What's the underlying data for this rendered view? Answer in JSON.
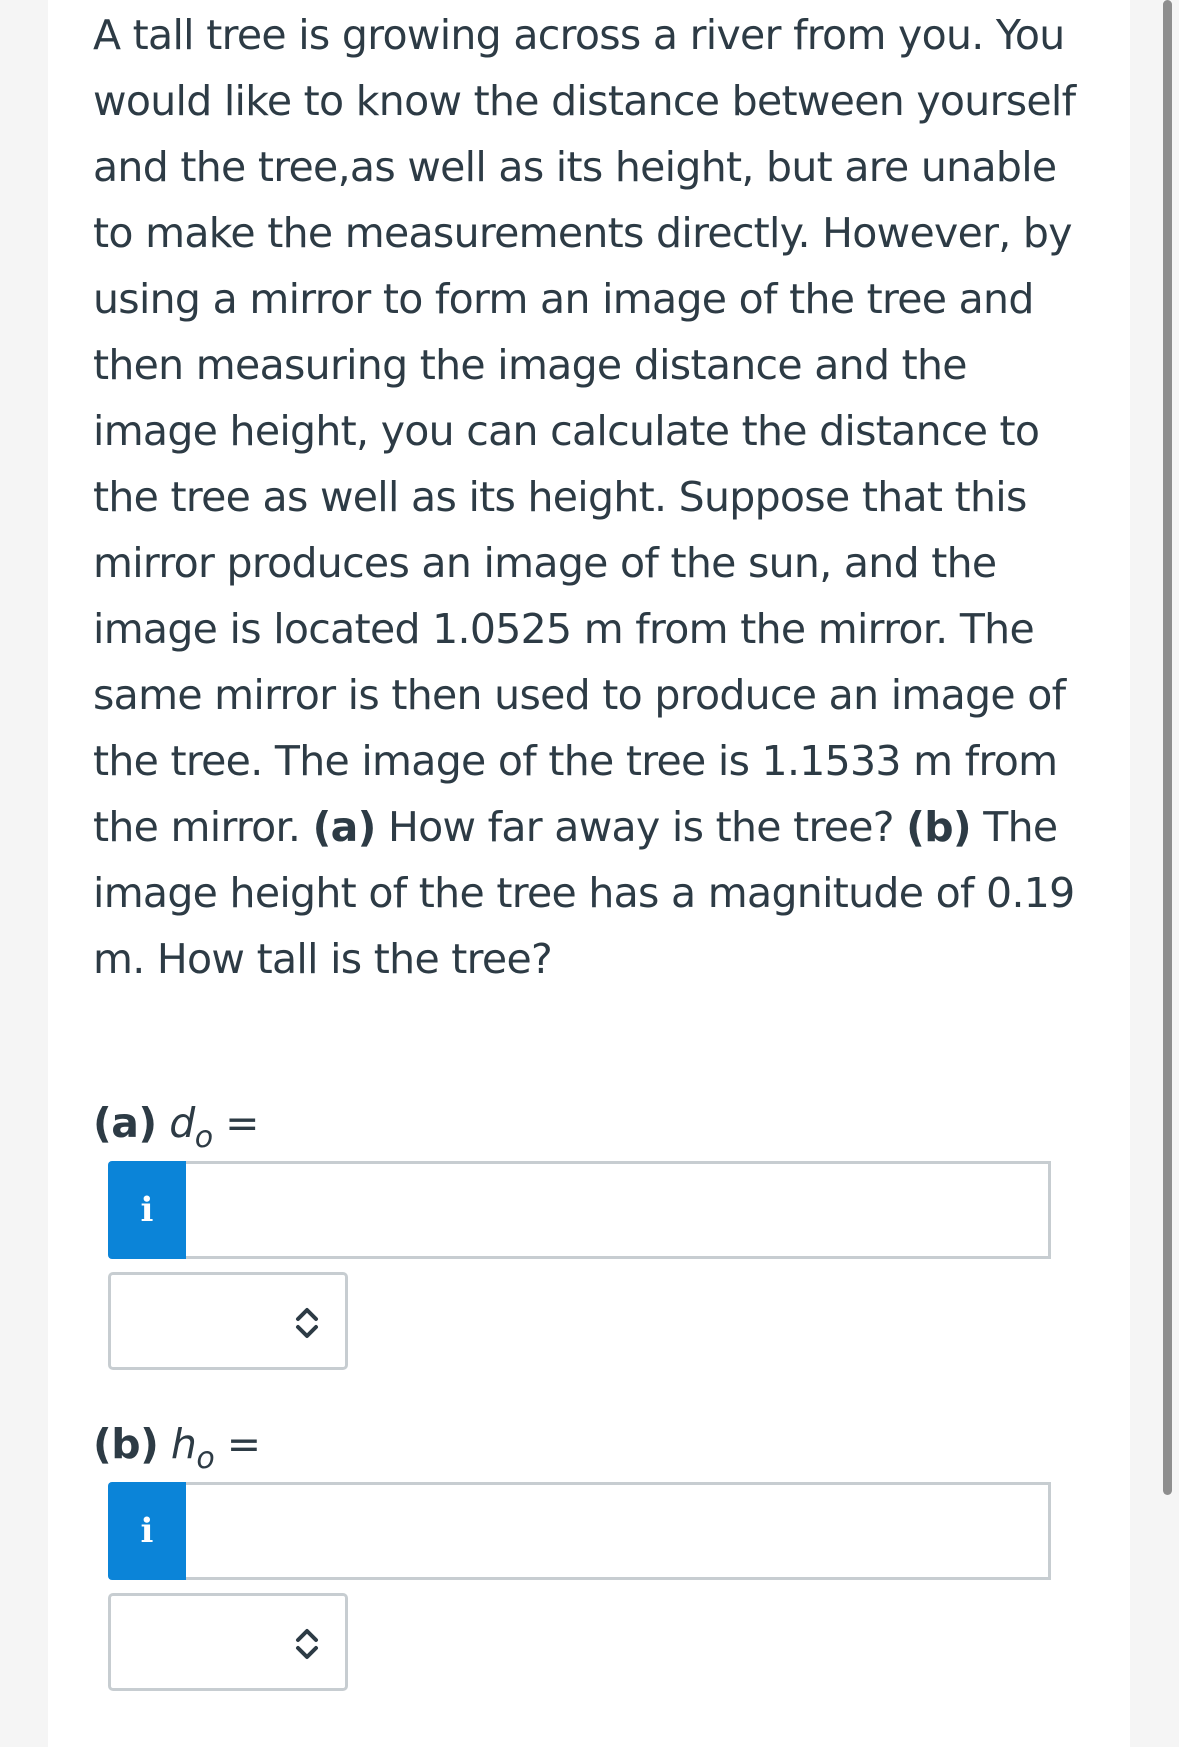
{
  "question": {
    "text_1": "A tall tree is growing across a river from you. You would like to know the distance between yourself and the tree,as well as its height, but are unable to make the measurements directly. However, by using a mirror to form an image of the tree and then measuring the image distance and the image height, you can calculate the distance to the tree as well as its height. Suppose that this mirror produces an image of the sun, and the image is located 1.0525 m from the mirror. The same mirror is then used to produce an image of the tree. The image of the tree is 1.1533 m from the mirror. ",
    "part_a_marker": "(a)",
    "text_2": " How far away is the tree? ",
    "part_b_marker": "(b)",
    "text_3": " The image height of the tree has a magnitude of 0.19 m. How tall is the tree?"
  },
  "part_a": {
    "marker": "(a)",
    "variable": "d",
    "subscript": "o",
    "equals": "=",
    "info_label": "i",
    "value": "",
    "unit_value": ""
  },
  "part_b": {
    "marker": "(b)",
    "variable": "h",
    "subscript": "o",
    "equals": "=",
    "info_label": "i",
    "value": "",
    "unit_value": ""
  },
  "icons": {
    "info": "info-icon",
    "select": "chevron-up-down-icon"
  },
  "colors": {
    "info_button": "#0b84d8",
    "text": "#2d3b45",
    "border": "#c7cdd1"
  }
}
